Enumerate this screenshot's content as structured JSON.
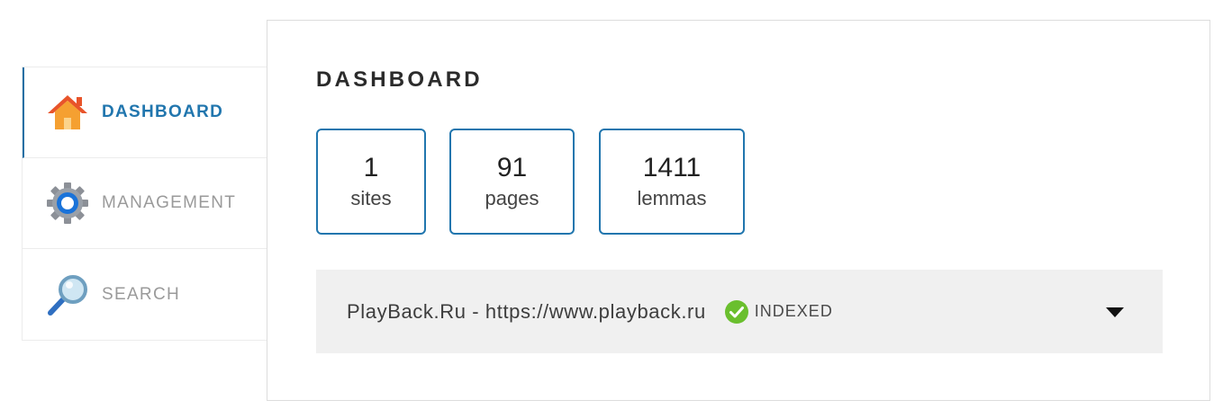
{
  "sidebar": {
    "items": [
      {
        "label": "DASHBOARD",
        "icon": "home-icon",
        "active": true
      },
      {
        "label": "MANAGEMENT",
        "icon": "gear-icon",
        "active": false
      },
      {
        "label": "SEARCH",
        "icon": "magnifier-icon",
        "active": false
      }
    ]
  },
  "main": {
    "title": "DASHBOARD",
    "stats": [
      {
        "value": "1",
        "label": "sites"
      },
      {
        "value": "91",
        "label": "pages"
      },
      {
        "value": "1411",
        "label": "lemmas"
      }
    ],
    "sites": [
      {
        "name": "PlayBack.Ru - https://www.playback.ru",
        "status": "INDEXED",
        "status_icon": "check-circle-icon"
      }
    ]
  },
  "colors": {
    "accent": "#2176ae",
    "status_ok": "#6abf2e",
    "row_bg": "#f0f0f0",
    "home_orange": "#f5a031"
  }
}
